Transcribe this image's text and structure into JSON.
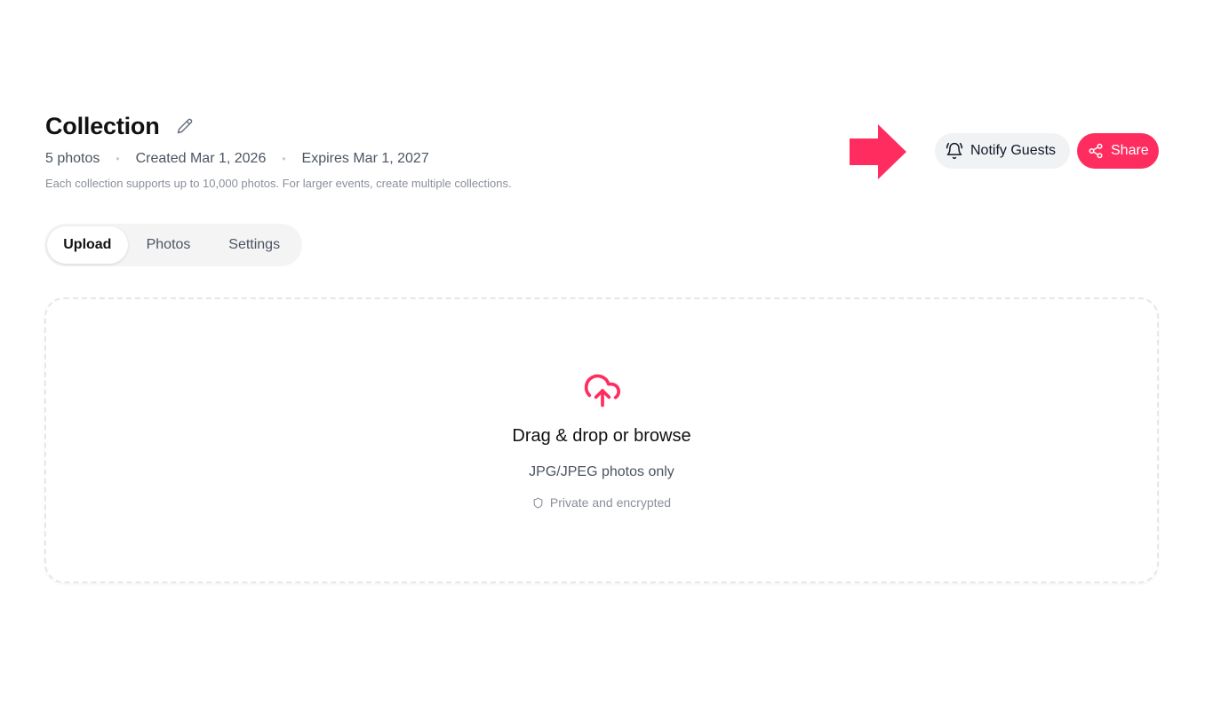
{
  "header": {
    "title": "Collection",
    "edit_icon": "pencil-icon",
    "photo_count": "5 photos",
    "created": "Created Mar 1, 2026",
    "expires": "Expires Mar 1, 2027",
    "separator": "•",
    "note": "Each collection supports up to 10,000 photos. For larger events, create multiple collections."
  },
  "annotation": {
    "arrow_icon": "arrow-right-icon",
    "color": "#ff2d5f"
  },
  "actions": {
    "notify_label": "Notify Guests",
    "notify_icon": "bell-icon",
    "share_label": "Share",
    "share_icon": "share-icon",
    "accent_color": "#ff2d5f"
  },
  "tabs": [
    {
      "label": "Upload",
      "active": true
    },
    {
      "label": "Photos",
      "active": false
    },
    {
      "label": "Settings",
      "active": false
    }
  ],
  "dropzone": {
    "icon": "cloud-upload-icon",
    "title": "Drag & drop or browse",
    "subtitle": "JPG/JPEG photos only",
    "privacy_icon": "shield-icon",
    "privacy_text": "Private and encrypted"
  }
}
